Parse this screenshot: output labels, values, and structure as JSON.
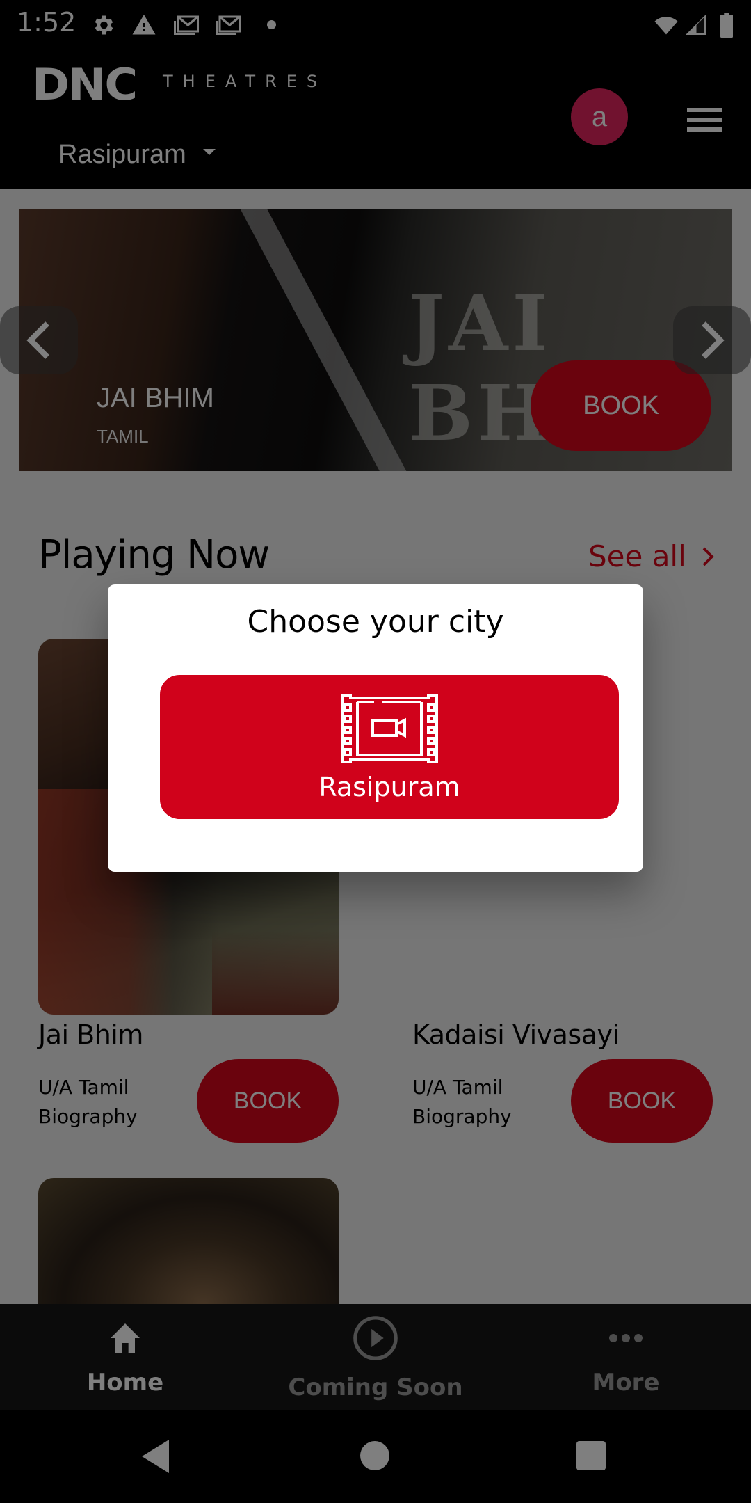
{
  "status_bar": {
    "time": "1:52",
    "icons": [
      "gear-icon",
      "warning-icon",
      "gmail-icon",
      "gmail-icon",
      "dot-icon",
      "wifi-icon",
      "signal-icon",
      "battery-icon"
    ]
  },
  "header": {
    "logo_mark": "DNC",
    "logo_text": "THEATRES",
    "city": "Rasipuram",
    "avatar_initial": "a",
    "colors": {
      "avatar": "#e3245f"
    }
  },
  "banner": {
    "poster_text": "JAI BHIM",
    "title": "JAI BHIM",
    "language": "TAMIL",
    "book_label": "BOOK"
  },
  "playing_now": {
    "title": "Playing Now",
    "see_all_label": "See all",
    "movies": [
      {
        "title": "Jai Bhim",
        "certificate_language": "U/A Tamil",
        "genre": "Biography",
        "book_label": "BOOK"
      },
      {
        "title": "Kadaisi Vivasayi",
        "certificate_language": "U/A Tamil",
        "genre": "Biography",
        "book_label": "BOOK"
      }
    ]
  },
  "bottom_nav": {
    "items": [
      {
        "label": "Home",
        "icon": "home-icon",
        "active": true
      },
      {
        "label": "Coming Soon",
        "icon": "play-circle-icon",
        "active": false
      },
      {
        "label": "More",
        "icon": "more-dots-icon",
        "active": false
      }
    ]
  },
  "dialog": {
    "title": "Choose your city",
    "cities": [
      {
        "name": "Rasipuram",
        "icon": "film-camera-icon"
      }
    ]
  },
  "colors": {
    "accent": "#d4061a",
    "dialog_button": "#d0021b"
  }
}
